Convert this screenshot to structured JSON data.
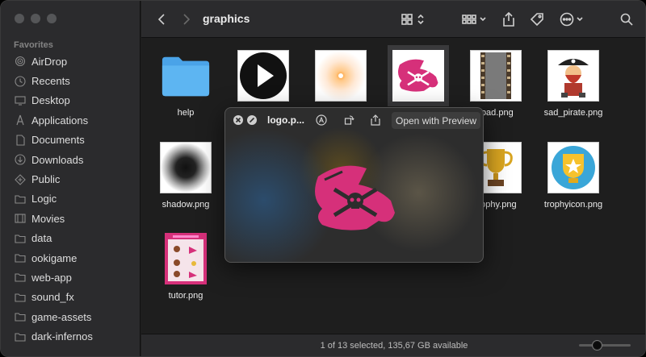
{
  "window": {
    "title": "graphics"
  },
  "sidebar": {
    "section_label": "Favorites",
    "items": [
      {
        "label": "AirDrop",
        "icon": "airdrop-icon"
      },
      {
        "label": "Recents",
        "icon": "clock-icon"
      },
      {
        "label": "Desktop",
        "icon": "desktop-icon"
      },
      {
        "label": "Applications",
        "icon": "applications-icon"
      },
      {
        "label": "Documents",
        "icon": "document-icon"
      },
      {
        "label": "Downloads",
        "icon": "download-icon"
      },
      {
        "label": "Public",
        "icon": "public-icon"
      },
      {
        "label": "Logic",
        "icon": "folder-icon"
      },
      {
        "label": "Movies",
        "icon": "film-icon"
      },
      {
        "label": "data",
        "icon": "folder-icon"
      },
      {
        "label": "ookigame",
        "icon": "folder-icon"
      },
      {
        "label": "web-app",
        "icon": "folder-icon"
      },
      {
        "label": "sound_fx",
        "icon": "folder-icon"
      },
      {
        "label": "game-assets",
        "icon": "folder-icon"
      },
      {
        "label": "dark-infernos",
        "icon": "folder-icon"
      }
    ]
  },
  "files": [
    {
      "name": "help",
      "kind": "folder"
    },
    {
      "name": "",
      "kind": "play"
    },
    {
      "name": "",
      "kind": "glow"
    },
    {
      "name": "",
      "kind": "logo"
    },
    {
      "name": "road.png",
      "kind": "road"
    },
    {
      "name": "sad_pirate.png",
      "kind": "pirate"
    },
    {
      "name": "shadow.png",
      "kind": "shadow"
    },
    {
      "name": "trophy.png",
      "kind": "trophy"
    },
    {
      "name": "trophyicon.png",
      "kind": "trophyicon"
    },
    {
      "name": "tutor.png",
      "kind": "tutor"
    }
  ],
  "quicklook": {
    "title": "logo.p...",
    "open_with": "Open with Preview"
  },
  "status": {
    "text": "1 of 13 selected, 135,67 GB available"
  },
  "colors": {
    "pirate_pink": "#d6307a",
    "folder_blue": "#4aa3e8"
  }
}
